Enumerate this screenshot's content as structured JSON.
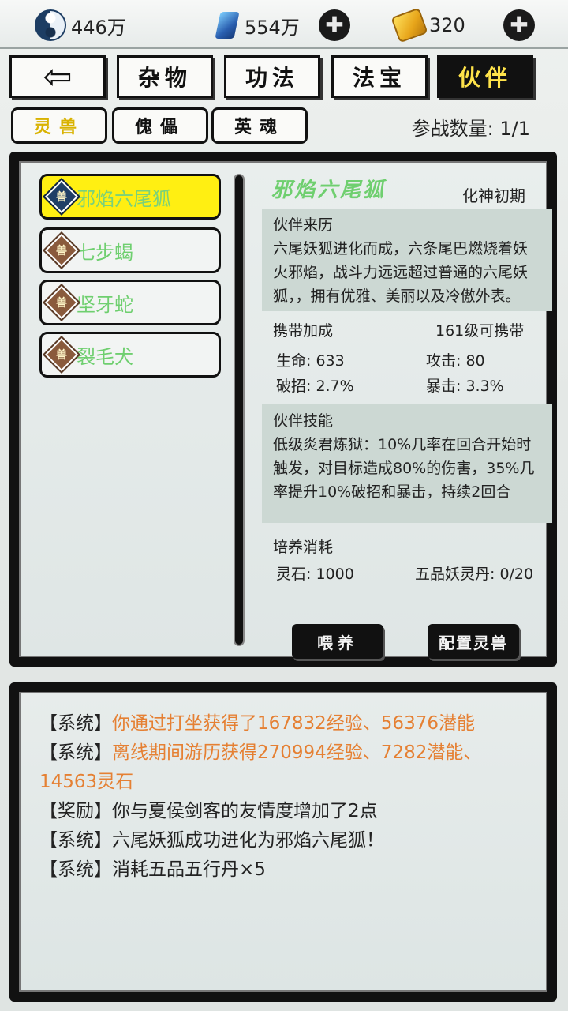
{
  "currency": {
    "silver": "446万",
    "gems": "554万",
    "gold": "320"
  },
  "tabs": {
    "misc": "杂物",
    "skills": "功法",
    "treasure": "法宝",
    "partner": "伙伴"
  },
  "subtabs": {
    "spirit_beast": "灵兽",
    "puppet": "傀儡",
    "hero_soul": "英魂"
  },
  "battle_count": "参战数量: 1/1",
  "pets": [
    {
      "badge": "兽",
      "name": "邪焰六尾狐"
    },
    {
      "badge": "兽",
      "name": "七步蝎"
    },
    {
      "badge": "兽",
      "name": "坚牙蛇"
    },
    {
      "badge": "兽",
      "name": "裂毛犬"
    }
  ],
  "detail": {
    "name": "邪焰六尾狐",
    "stage": "化神初期",
    "origin_title": "伙伴来历",
    "origin_text": "六尾妖狐进化而成，六条尾巴燃烧着妖火邪焰，战斗力远远超过普通的六尾妖狐，，拥有优雅、美丽以及冷傲外表。",
    "bonus_title": "携带加成",
    "carry_level": "161级可携带",
    "hp": "生命: 633",
    "atk": "攻击: 80",
    "pierce": "破招: 2.7%",
    "crit": "暴击: 3.3%",
    "skill_title": "伙伴技能",
    "skill_text": "低级炎君炼狱：10%几率在回合开始时触发，对目标造成80%的伤害，35%几率提升10%破招和暴击，持续2回合",
    "cost_title": "培养消耗",
    "cost_stone": "灵石: 1000",
    "cost_pill": "五品妖灵丹: 0/20",
    "feed_btn": "喂养",
    "config_btn": "配置灵兽"
  },
  "log": [
    {
      "tag": "【系统】",
      "text": "你通过打坐获得了167832经验、56376潜能",
      "color": "orange"
    },
    {
      "tag": "【系统】",
      "text": "离线期间游历获得270994经验、7282潜能、14563灵石",
      "color": "orange"
    },
    {
      "tag": "【奖励】",
      "text": "你与夏侯剑客的友情度增加了2点",
      "color": "black"
    },
    {
      "tag": "【系统】",
      "text": "六尾妖狐成功进化为邪焰六尾狐！",
      "color": "black"
    },
    {
      "tag": "【系统】",
      "text": "消耗五品五行丹×5",
      "color": "black"
    }
  ],
  "colors": {
    "active_pet_bg": "#ffef12",
    "pet_name": "#6fcf6f",
    "log_orange": "#e58033"
  }
}
